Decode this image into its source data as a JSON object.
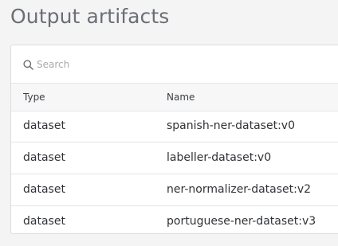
{
  "page": {
    "title": "Output artifacts"
  },
  "search": {
    "placeholder": "Search",
    "value": ""
  },
  "table": {
    "headers": {
      "type": "Type",
      "name": "Name"
    },
    "rows": [
      {
        "type": "dataset",
        "name": "spanish-ner-dataset:v0"
      },
      {
        "type": "dataset",
        "name": "labeller-dataset:v0"
      },
      {
        "type": "dataset",
        "name": "ner-normalizer-dataset:v2"
      },
      {
        "type": "dataset",
        "name": "portuguese-ner-dataset:v3"
      }
    ]
  },
  "icons": {
    "search": "search-icon"
  }
}
